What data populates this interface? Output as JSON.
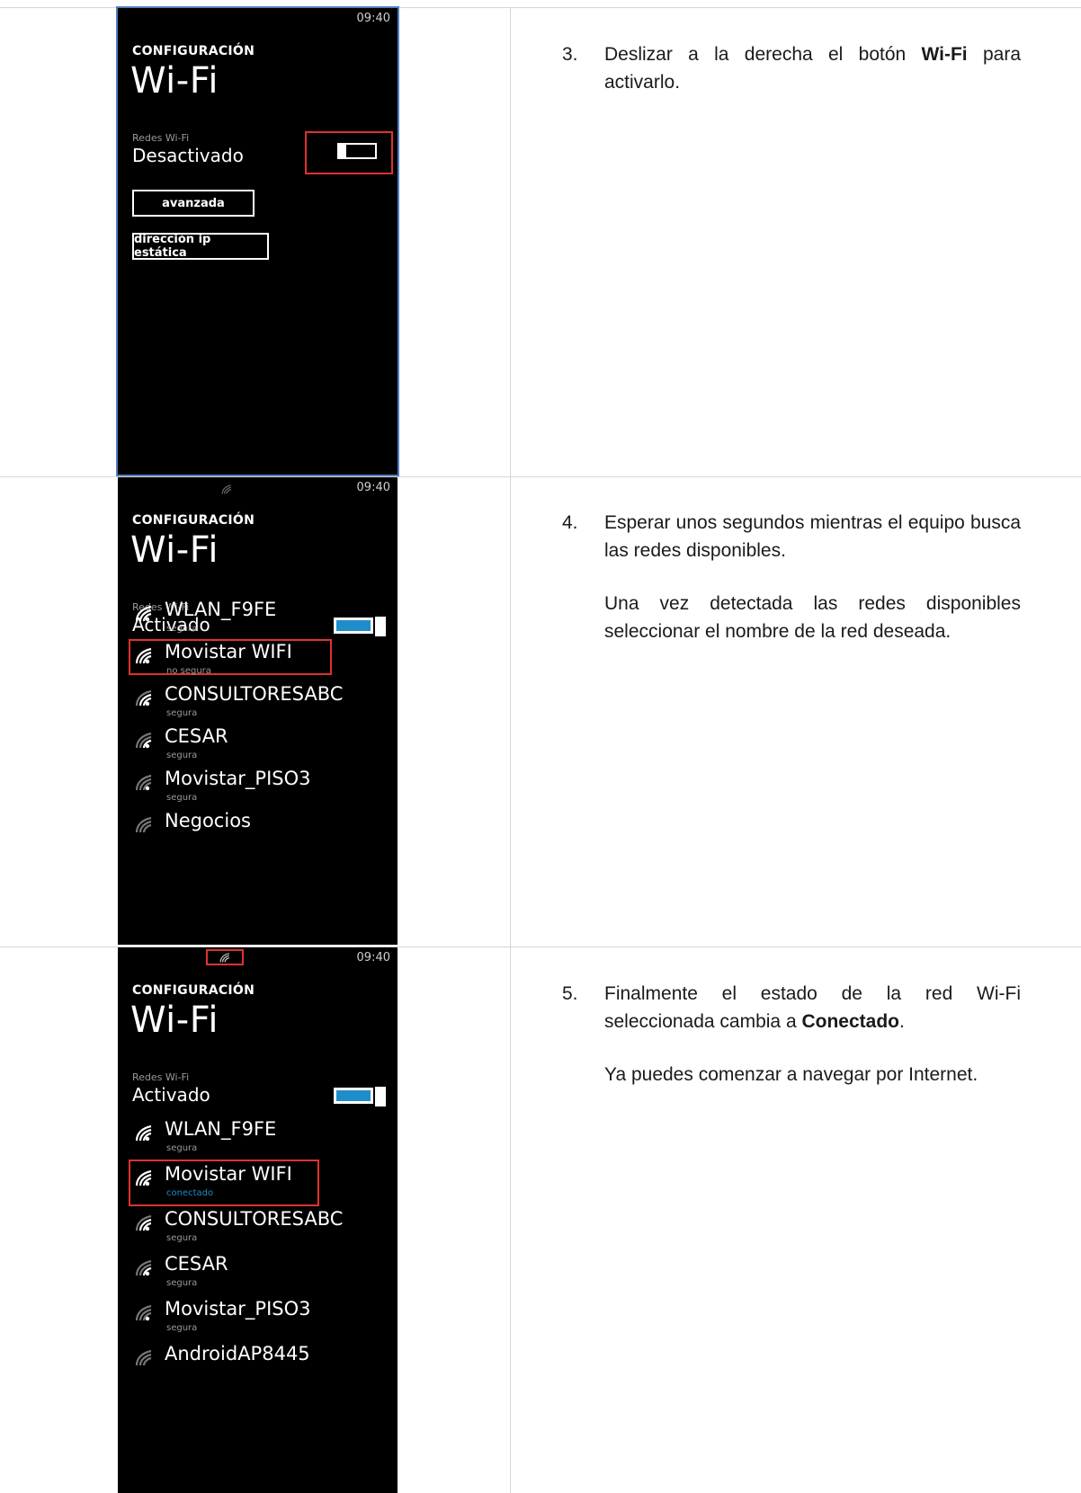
{
  "phone1": {
    "time": "09:40",
    "settings_label": "CONFIGURACIÓN",
    "title": "Wi-Fi",
    "networks_label": "Redes Wi-Fi",
    "state": "Desactivado",
    "button_advanced": "avanzada",
    "button_static_ip": "dirección ip estática"
  },
  "phone2": {
    "time": "09:40",
    "settings_label": "CONFIGURACIÓN",
    "title": "Wi-Fi",
    "networks_label": "Redes Wi-Fi",
    "state": "Activado",
    "networks": [
      {
        "name": "WLAN_F9FE",
        "status": "segura"
      },
      {
        "name": "Movistar WIFI",
        "status": "no segura"
      },
      {
        "name": "CONSULTORESABC",
        "status": "segura"
      },
      {
        "name": "CESAR",
        "status": "segura"
      },
      {
        "name": "Movistar_PISO3",
        "status": "segura"
      },
      {
        "name": "Negocios",
        "status": ""
      }
    ]
  },
  "phone3": {
    "time": "09:40",
    "settings_label": "CONFIGURACIÓN",
    "title": "Wi-Fi",
    "networks_label": "Redes Wi-Fi",
    "state": "Activado",
    "networks": [
      {
        "name": "WLAN_F9FE",
        "status": "segura"
      },
      {
        "name": "Movistar WIFI",
        "status": "conectado"
      },
      {
        "name": "CONSULTORESABC",
        "status": "segura"
      },
      {
        "name": "CESAR",
        "status": "segura"
      },
      {
        "name": "Movistar_PISO3",
        "status": "segura"
      },
      {
        "name": "AndroidAP8445",
        "status": ""
      }
    ]
  },
  "steps": [
    {
      "num": "3.",
      "p1_pre": "Deslizar a la derecha el botón ",
      "p1_bold": "Wi-Fi",
      "p1_post": " para activarlo."
    },
    {
      "num": "4.",
      "p1": "Esperar unos segundos mientras el equipo busca las redes disponibles.",
      "p2": "Una vez detectada las redes disponibles seleccionar el nombre de la red deseada."
    },
    {
      "num": "5.",
      "p1_pre": "Finalmente el estado de la red Wi-Fi seleccionada cambia a ",
      "p1_bold": "Conectado",
      "p1_post": ".",
      "p2": "Ya puedes comenzar a navegar por Internet."
    }
  ],
  "colors": {
    "accent": "#1f8dc9",
    "highlight": "#e0322e",
    "frame": "#4f7fc1"
  },
  "icons": [
    "wifi-signal-icon"
  ]
}
